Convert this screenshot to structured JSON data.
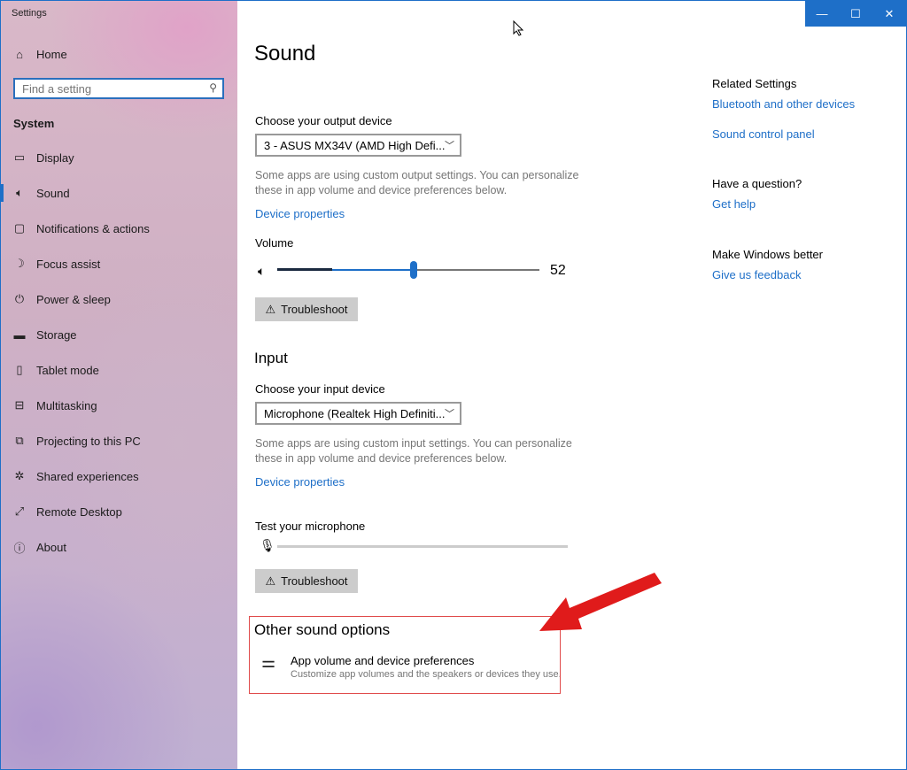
{
  "window": {
    "title": "Settings"
  },
  "titlebar": {
    "minimize": "—",
    "maximize": "☐",
    "close": "✕"
  },
  "sidebar": {
    "home_label": "Home",
    "search_placeholder": "Find a setting",
    "group_title": "System",
    "items": [
      {
        "label": "Display",
        "icon": "display-icon"
      },
      {
        "label": "Sound",
        "icon": "speaker-icon",
        "active": true
      },
      {
        "label": "Notifications & actions",
        "icon": "notification-icon"
      },
      {
        "label": "Focus assist",
        "icon": "moon-icon"
      },
      {
        "label": "Power & sleep",
        "icon": "power-icon"
      },
      {
        "label": "Storage",
        "icon": "storage-icon"
      },
      {
        "label": "Tablet mode",
        "icon": "tablet-icon"
      },
      {
        "label": "Multitasking",
        "icon": "multitasking-icon"
      },
      {
        "label": "Projecting to this PC",
        "icon": "projecting-icon"
      },
      {
        "label": "Shared experiences",
        "icon": "shared-icon"
      },
      {
        "label": "Remote Desktop",
        "icon": "remote-icon"
      },
      {
        "label": "About",
        "icon": "info-icon"
      }
    ]
  },
  "main": {
    "title": "Sound",
    "output": {
      "label": "Choose your output device",
      "selected": "3 - ASUS MX34V (AMD High Defi...",
      "desc": "Some apps are using custom output settings. You can personalize these in app volume and device preferences below.",
      "device_properties": "Device properties",
      "volume_label": "Volume",
      "volume_value": "52",
      "volume_fraction": 0.52,
      "troubleshoot": "Troubleshoot"
    },
    "input": {
      "heading": "Input",
      "label": "Choose your input device",
      "selected": "Microphone (Realtek High Definiti...",
      "desc": "Some apps are using custom input settings. You can personalize these in app volume and device preferences below.",
      "device_properties": "Device properties",
      "test_label": "Test your microphone",
      "troubleshoot": "Troubleshoot"
    },
    "other": {
      "heading": "Other sound options",
      "item_title": "App volume and device preferences",
      "item_desc": "Customize app volumes and the speakers or devices they use."
    }
  },
  "related": {
    "heading": "Related Settings",
    "links": [
      "Bluetooth and other devices",
      "Sound control panel"
    ],
    "question_heading": "Have a question?",
    "get_help": "Get help",
    "better_heading": "Make Windows better",
    "feedback": "Give us feedback"
  },
  "colors": {
    "accent": "#1e6fc8",
    "annotation_red": "#e01b1b"
  }
}
